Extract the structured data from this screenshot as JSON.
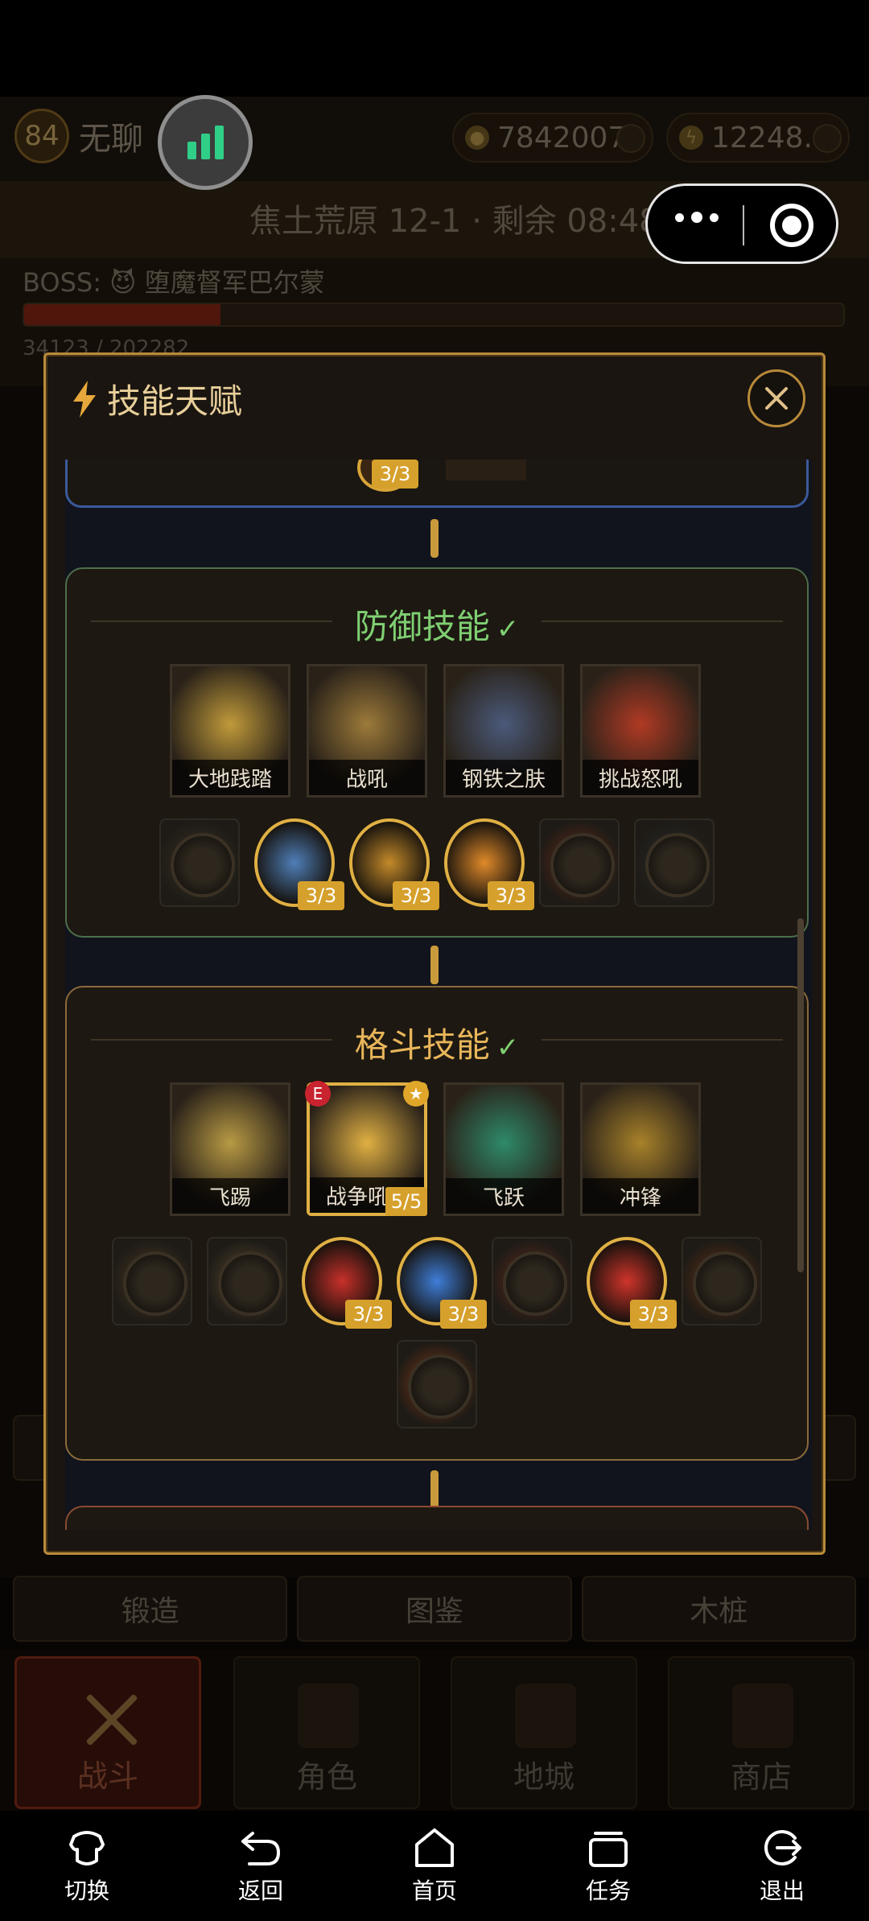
{
  "player": {
    "level": "84",
    "name": "无聊"
  },
  "resources": {
    "gold": "7842007",
    "energy": "12248.0"
  },
  "stage": {
    "text": "焦土荒原 12-1 · 剩余 08:48"
  },
  "boss": {
    "label": "BOSS: 😈 堕魔督军巴尔蒙",
    "hp_text": "34123 / 202282",
    "hp_fraction": 0.24
  },
  "modal": {
    "title": "技能天赋",
    "sections": [
      {
        "title": "防御技能",
        "check": "✓",
        "skills": [
          {
            "name": "大地践踏",
            "color": "#c09a3a"
          },
          {
            "name": "战吼",
            "color": "#9c7a3a"
          },
          {
            "name": "钢铁之肤",
            "color": "#4a5a7a"
          },
          {
            "name": "挑战怒吼",
            "color": "#b03a24"
          }
        ],
        "talents": [
          {
            "level": "",
            "on": false,
            "color": "#3a3124"
          },
          {
            "level": "3/3",
            "on": true,
            "color": "#4f7fb8"
          },
          {
            "level": "3/3",
            "on": true,
            "color": "#c48a2a"
          },
          {
            "level": "3/3",
            "on": true,
            "color": "#e08a2a"
          },
          {
            "level": "",
            "on": false,
            "color": "#6a2a1a"
          },
          {
            "level": "",
            "on": false,
            "color": "#2a2a2a"
          }
        ]
      },
      {
        "title": "格斗技能",
        "check": "✓",
        "skills": [
          {
            "name": "飞踢",
            "color": "#b89a44",
            "selected": false
          },
          {
            "name": "战争吼",
            "color": "#e0b043",
            "selected": true,
            "badge_e": "E",
            "badge_star": "★",
            "level": "5/5"
          },
          {
            "name": "飞跃",
            "color": "#2e8a6a",
            "selected": false
          },
          {
            "name": "冲锋",
            "color": "#a8822a",
            "selected": false
          }
        ],
        "talents": [
          {
            "level": "",
            "on": false,
            "color": "#4a3a22"
          },
          {
            "level": "",
            "on": false,
            "color": "#5a4a32"
          },
          {
            "level": "3/3",
            "on": true,
            "color": "#c8302a"
          },
          {
            "level": "3/3",
            "on": true,
            "color": "#3f7ed8"
          },
          {
            "level": "",
            "on": false,
            "color": "#6a2a1e"
          },
          {
            "level": "3/3",
            "on": true,
            "color": "#d0342a"
          },
          {
            "level": "",
            "on": false,
            "color": "#6a3014"
          },
          {
            "level": "",
            "on": false,
            "color": "#8a3a14"
          }
        ]
      }
    ],
    "prev_section_level": "3/3"
  },
  "bg_buttons": [
    "锻造",
    "图鉴",
    "木桩"
  ],
  "bottom_tabs": [
    "战斗",
    "角色",
    "地城",
    "商店"
  ],
  "system_nav": [
    "切换",
    "返回",
    "首页",
    "任务",
    "退出"
  ]
}
